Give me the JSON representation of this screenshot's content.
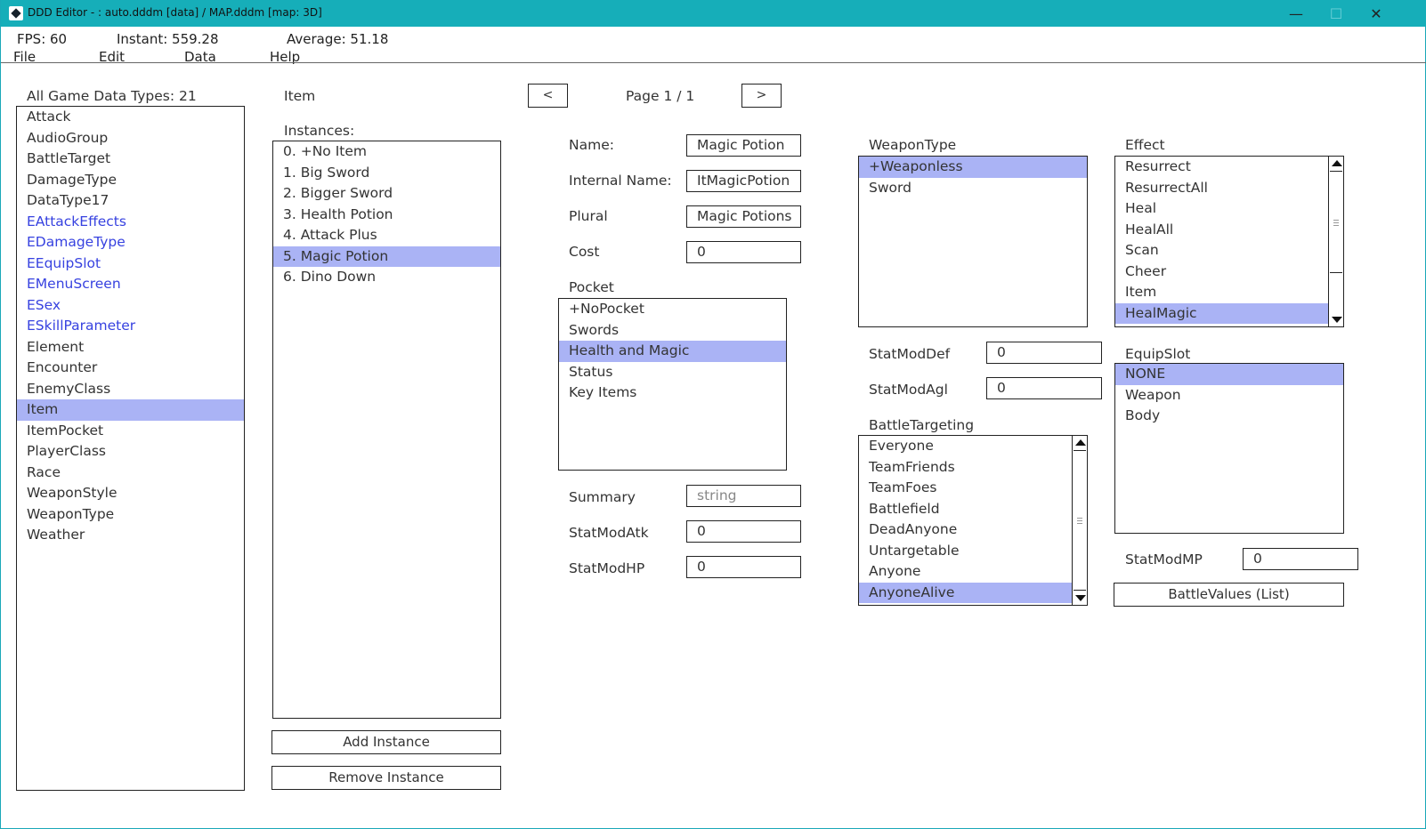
{
  "window": {
    "title": "DDD Editor - : auto.dddm [data] / MAP.dddm [map: 3D]",
    "minimize_glyph": "—",
    "maximize_glyph": "☐",
    "close_glyph": "✕"
  },
  "stats": {
    "fps": "FPS: 60",
    "instant": "Instant: 559.28",
    "average": "Average: 51.18"
  },
  "menubar": {
    "file": "File",
    "edit": "Edit",
    "data": "Data",
    "help": "Help"
  },
  "types_panel": {
    "header": "All Game Data Types: 21",
    "items": [
      {
        "label": "Attack"
      },
      {
        "label": "AudioGroup"
      },
      {
        "label": "BattleTarget"
      },
      {
        "label": "DamageType"
      },
      {
        "label": "DataType17"
      },
      {
        "label": "EAttackEffects"
      },
      {
        "label": "EDamageType"
      },
      {
        "label": "EEquipSlot"
      },
      {
        "label": "EMenuScreen"
      },
      {
        "label": "ESex"
      },
      {
        "label": "ESkillParameter"
      },
      {
        "label": "Element"
      },
      {
        "label": "Encounter"
      },
      {
        "label": "EnemyClass"
      },
      {
        "label": "Item"
      },
      {
        "label": "ItemPocket"
      },
      {
        "label": "PlayerClass"
      },
      {
        "label": "Race"
      },
      {
        "label": "WeaponStyle"
      },
      {
        "label": "WeaponType"
      },
      {
        "label": "Weather"
      }
    ],
    "selected": "Item"
  },
  "instances_panel": {
    "type_title": "Item",
    "header": "Instances:",
    "items": [
      {
        "label": "0. +No Item"
      },
      {
        "label": "1. Big Sword"
      },
      {
        "label": "2. Bigger Sword"
      },
      {
        "label": "3. Health Potion"
      },
      {
        "label": "4. Attack Plus"
      },
      {
        "label": "5. Magic Potion"
      },
      {
        "label": "6. Dino Down"
      }
    ],
    "selected": "5. Magic Potion",
    "add_button": "Add Instance",
    "remove_button": "Remove Instance"
  },
  "pager": {
    "prev": "<",
    "next": ">",
    "label": "Page 1 / 1"
  },
  "fields": {
    "name_label": "Name:",
    "name_value": "Magic Potion",
    "internal_label": "Internal Name:",
    "internal_value": "ItMagicPotion",
    "plural_label": "Plural",
    "plural_value": "Magic Potions",
    "cost_label": "Cost",
    "cost_value": "0",
    "summary_label": "Summary",
    "summary_placeholder": "string",
    "atk_label": "StatModAtk",
    "atk_value": "0",
    "hp_label": "StatModHP",
    "hp_value": "0",
    "def_label": "StatModDef",
    "def_value": "0",
    "agl_label": "StatModAgl",
    "agl_value": "0",
    "mp_label": "StatModMP",
    "mp_value": "0",
    "battle_values_button": "BattleValues (List)"
  },
  "pocket": {
    "header": "Pocket",
    "items": [
      {
        "label": "+NoPocket"
      },
      {
        "label": "Swords"
      },
      {
        "label": "Health and Magic"
      },
      {
        "label": "Status"
      },
      {
        "label": "Key Items"
      }
    ],
    "selected": "Health and Magic"
  },
  "weapon_type": {
    "header": "WeaponType",
    "items": [
      {
        "label": "+Weaponless"
      },
      {
        "label": "Sword"
      }
    ],
    "selected": "+Weaponless"
  },
  "effect": {
    "header": "Effect",
    "items": [
      {
        "label": "Resurrect"
      },
      {
        "label": "ResurrectAll"
      },
      {
        "label": "Heal"
      },
      {
        "label": "HealAll"
      },
      {
        "label": "Scan"
      },
      {
        "label": "Cheer"
      },
      {
        "label": "Item"
      },
      {
        "label": "HealMagic"
      }
    ],
    "selected": "HealMagic"
  },
  "equip_slot": {
    "header": "EquipSlot",
    "items": [
      {
        "label": "NONE"
      },
      {
        "label": "Weapon"
      },
      {
        "label": "Body"
      }
    ],
    "selected": "NONE"
  },
  "battle_targeting": {
    "header": "BattleTargeting",
    "items": [
      {
        "label": "Everyone"
      },
      {
        "label": "TeamFriends"
      },
      {
        "label": "TeamFoes"
      },
      {
        "label": "Battlefield"
      },
      {
        "label": "DeadAnyone"
      },
      {
        "label": "Untargetable"
      },
      {
        "label": "Anyone"
      },
      {
        "label": "AnyoneAlive"
      }
    ],
    "selected": "AnyoneAlive"
  },
  "colors": {
    "titlebar": "#16aeb9",
    "selection": "#aab3f5",
    "enum_text": "#3742e0"
  }
}
